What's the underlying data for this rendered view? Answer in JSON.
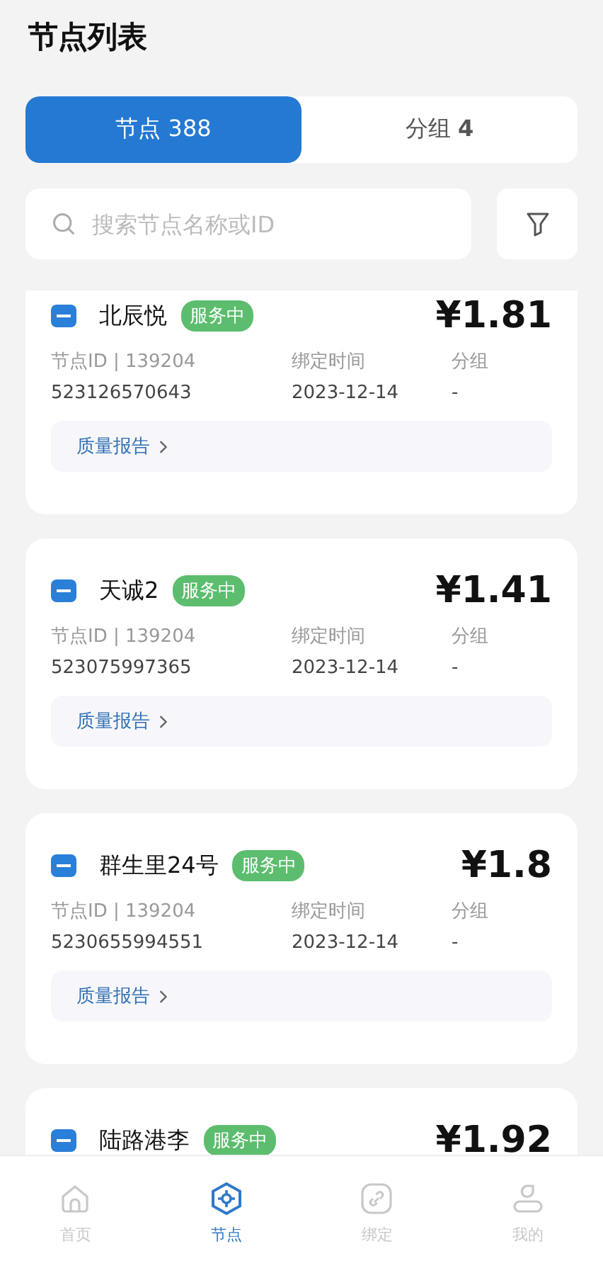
{
  "title": "节点列表",
  "tabs": [
    {
      "label": "节点",
      "count": "388",
      "selected": true
    },
    {
      "label": "分组",
      "count": "4",
      "selected": false
    }
  ],
  "search": {
    "placeholder": "搜索节点名称或ID"
  },
  "nodes": [
    {
      "name": "北辰悦",
      "status": "服务中",
      "price": "¥1.81",
      "id_label": "节点ID | 139204",
      "id_line2": "523126570643",
      "bind_label": "绑定时间",
      "bind_date": "2023-12-14",
      "group_label": "分组",
      "group": "-",
      "report": "质量报告"
    },
    {
      "name": "天诚2",
      "status": "服务中",
      "price": "¥1.41",
      "id_label": "节点ID | 139204",
      "id_line2": "523075997365",
      "bind_label": "绑定时间",
      "bind_date": "2023-12-14",
      "group_label": "分组",
      "group": "-",
      "report": "质量报告"
    },
    {
      "name": "群生里24号",
      "status": "服务中",
      "price": "¥1.8",
      "id_label": "节点ID | 139204",
      "id_line2": "5230655994551",
      "bind_label": "绑定时间",
      "bind_date": "2023-12-14",
      "group_label": "分组",
      "group": "-",
      "report": "质量报告"
    },
    {
      "name": "陆路港李",
      "status": "服务中",
      "price": "¥1.92"
    }
  ],
  "nav": [
    {
      "kind": "home",
      "label": "首页",
      "selected": false
    },
    {
      "kind": "node",
      "label": "节点",
      "selected": true
    },
    {
      "kind": "link",
      "label": "绑定",
      "selected": false
    },
    {
      "kind": "user",
      "label": "我的",
      "selected": false
    }
  ]
}
